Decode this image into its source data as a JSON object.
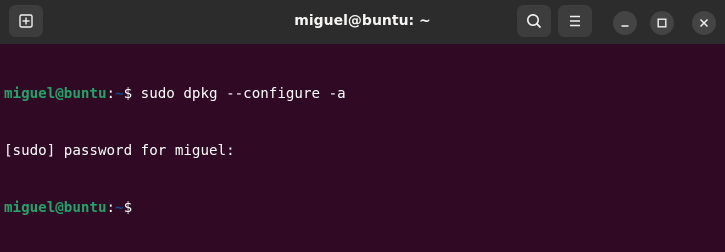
{
  "window": {
    "title": "miguel@buntu: ~"
  },
  "header": {
    "icons": {
      "new_tab": "new-tab-icon",
      "search": "search-icon",
      "menu": "hamburger-menu-icon",
      "minimize": "minimize-icon",
      "maximize": "maximize-icon",
      "close": "close-icon"
    }
  },
  "terminal": {
    "lines": [
      {
        "user": "miguel@buntu",
        "sep": ":",
        "path": "~",
        "prompt": "$",
        "command": " sudo dpkg --configure -a"
      },
      {
        "text": "[sudo] password for miguel:"
      },
      {
        "user": "miguel@buntu",
        "sep": ":",
        "path": "~",
        "prompt": "$",
        "command": ""
      }
    ]
  },
  "colors": {
    "background": "#300a24",
    "titlebar": "#2c2c2c",
    "prompt_user": "#26a269",
    "prompt_path": "#12488b",
    "text": "#ffffff"
  }
}
